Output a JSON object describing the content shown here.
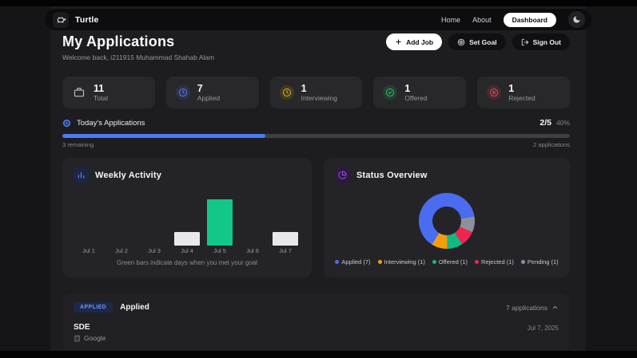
{
  "navbar": {
    "brand": "Turtle",
    "links": [
      {
        "label": "Home"
      },
      {
        "label": "About"
      }
    ],
    "dashboard": "Dashboard"
  },
  "header": {
    "title": "My Applications",
    "welcome": "Welcome back, i211915 Muhammad Shahab Alam",
    "add_job": "Add Job",
    "set_goal": "Set Goal",
    "sign_out": "Sign Out"
  },
  "stats": [
    {
      "value": "11",
      "label": "Total",
      "icon": "briefcase-icon",
      "color": "#b9bcc4",
      "bg": "transparent"
    },
    {
      "value": "7",
      "label": "Applied",
      "icon": "clock-icon",
      "color": "#5b7ef5",
      "bg": "rgba(75,110,240,0.16)"
    },
    {
      "value": "1",
      "label": "Interviewing",
      "icon": "clock-icon",
      "color": "#e7b30a",
      "bg": "rgba(230,180,10,0.14)"
    },
    {
      "value": "1",
      "label": "Offered",
      "icon": "check-circle-icon",
      "color": "#2bc56a",
      "bg": "rgba(40,200,110,0.14)"
    },
    {
      "value": "1",
      "label": "Rejected",
      "icon": "x-circle-icon",
      "color": "#ef4456",
      "bg": "rgba(240,70,90,0.14)"
    }
  ],
  "today": {
    "label": "Today’s Applications",
    "ratio": "2/5",
    "percent_label": "40%",
    "percent": 40,
    "remaining": "3 remaining",
    "applications": "2 applications",
    "bar_color": "#4b7cf5"
  },
  "chart_data": [
    {
      "type": "bar",
      "title": "Weekly Activity",
      "categories": [
        "Jul 1",
        "Jul 2",
        "Jul 3",
        "Jul 4",
        "Jul 5",
        "Jul 6",
        "Jul 7"
      ],
      "values": [
        0,
        0,
        0,
        2,
        7,
        0,
        2
      ],
      "goal_met": [
        false,
        false,
        false,
        false,
        true,
        false,
        false
      ],
      "colors": {
        "met": "#12c788",
        "not_met": "#e9e9ec"
      },
      "ylim": [
        0,
        7
      ],
      "grid": false,
      "note": "Green bars indicate days when you met your goal"
    },
    {
      "type": "pie",
      "title": "Status Overview",
      "donut": true,
      "segments": [
        {
          "label": "Applied",
          "value": 7,
          "color": "#4a6cf0"
        },
        {
          "label": "Interviewing",
          "value": 1,
          "color": "#f59e0b"
        },
        {
          "label": "Offered",
          "value": 1,
          "color": "#10b981"
        },
        {
          "label": "Rejected",
          "value": 1,
          "color": "#f0254f"
        },
        {
          "label": "Pending",
          "value": 1,
          "color": "#8b919c"
        }
      ],
      "display_order": [
        0,
        4,
        3,
        2,
        1
      ],
      "start_angle": 212,
      "legend_position": "bottom"
    }
  ],
  "apps_section": {
    "badge": "APPLIED",
    "group_title": "Applied",
    "count_label": "7 applications",
    "items": [
      {
        "role": "SDE",
        "company": "Google",
        "date": "Jul 7, 2025"
      }
    ]
  }
}
